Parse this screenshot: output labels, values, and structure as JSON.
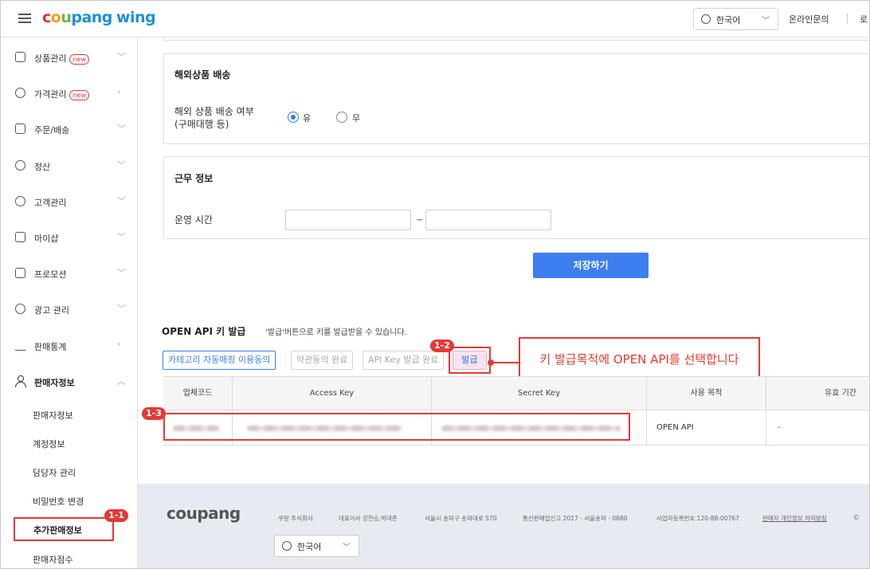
{
  "header": {
    "logo_parts": [
      "c",
      "o",
      "u",
      "pang"
    ],
    "logo_suffix": "wing",
    "language": "한국어",
    "contact": "온라인문의",
    "truncated": "로"
  },
  "sidebar": {
    "items": [
      {
        "label": "상품관리",
        "badge": "new",
        "icon": "box-icon"
      },
      {
        "label": "가격관리",
        "badge": "new",
        "icon": "price-tag-icon"
      },
      {
        "label": "주문/배송",
        "badge": "",
        "icon": "truck-icon"
      },
      {
        "label": "정산",
        "badge": "",
        "icon": "won-coin-icon"
      },
      {
        "label": "고객관리",
        "badge": "",
        "icon": "smile-icon"
      },
      {
        "label": "마이샵",
        "badge": "",
        "icon": "shop-icon"
      },
      {
        "label": "프로모션",
        "badge": "",
        "icon": "coupon-icon"
      },
      {
        "label": "광고 관리",
        "badge": "",
        "icon": "pie-icon"
      },
      {
        "label": "판매통계",
        "badge": "",
        "icon": "bar-chart-icon"
      }
    ],
    "seller_section": {
      "label": "판매자정보",
      "subitems": [
        "판매자정보",
        "계정정보",
        "담당자 관리",
        "비밀번호 변경",
        "추가판매정보",
        "판매자점수"
      ]
    }
  },
  "overseas": {
    "title": "해외상품 배송",
    "label_line1": "해외 상품 배송 여부",
    "label_line2": "(구매대행 등)",
    "option_yes": "유",
    "option_no": "무",
    "selected": "유"
  },
  "work": {
    "title": "근무 정보",
    "hours_label": "운영 시간",
    "range_sep": "~",
    "start_value": "",
    "end_value": ""
  },
  "save_button": "저장하기",
  "api": {
    "title": "OPEN API 키 발급",
    "description": "'발급'버튼으로 키를 발급받을 수 있습니다.",
    "tabs": [
      "카테고리 자동매칭 이용동의",
      "약관동의 완료",
      "API Key 발급 완료"
    ],
    "issue_button": "발급",
    "columns": [
      "업체코드",
      "Access Key",
      "Secret Key",
      "사용 목적",
      "유효 기간"
    ],
    "row": {
      "vendor_code": "",
      "access_key": "",
      "secret_key": "",
      "purpose": "OPEN API",
      "validity": "-"
    }
  },
  "annotations": {
    "step_1_1": "1-1",
    "step_1_2": "1-2",
    "step_1_3": "1-3",
    "callout": "키 발급목적에 OPEN API를 선택합니다",
    "accent_color": "#e53935"
  },
  "footer": {
    "logo": "coupang",
    "company": "쿠팡 주식회사",
    "ceo": "대표이사 강한승,박대준",
    "address": "서울시 송파구 송파대로 570",
    "mail_order": "통신판매업신고 2017 - 서울송파 - 0680",
    "biz_no": "사업자등록번호 120-88-00767",
    "privacy": "판매자 개인정보 처리방침",
    "copyright": "©",
    "language": "한국어"
  }
}
